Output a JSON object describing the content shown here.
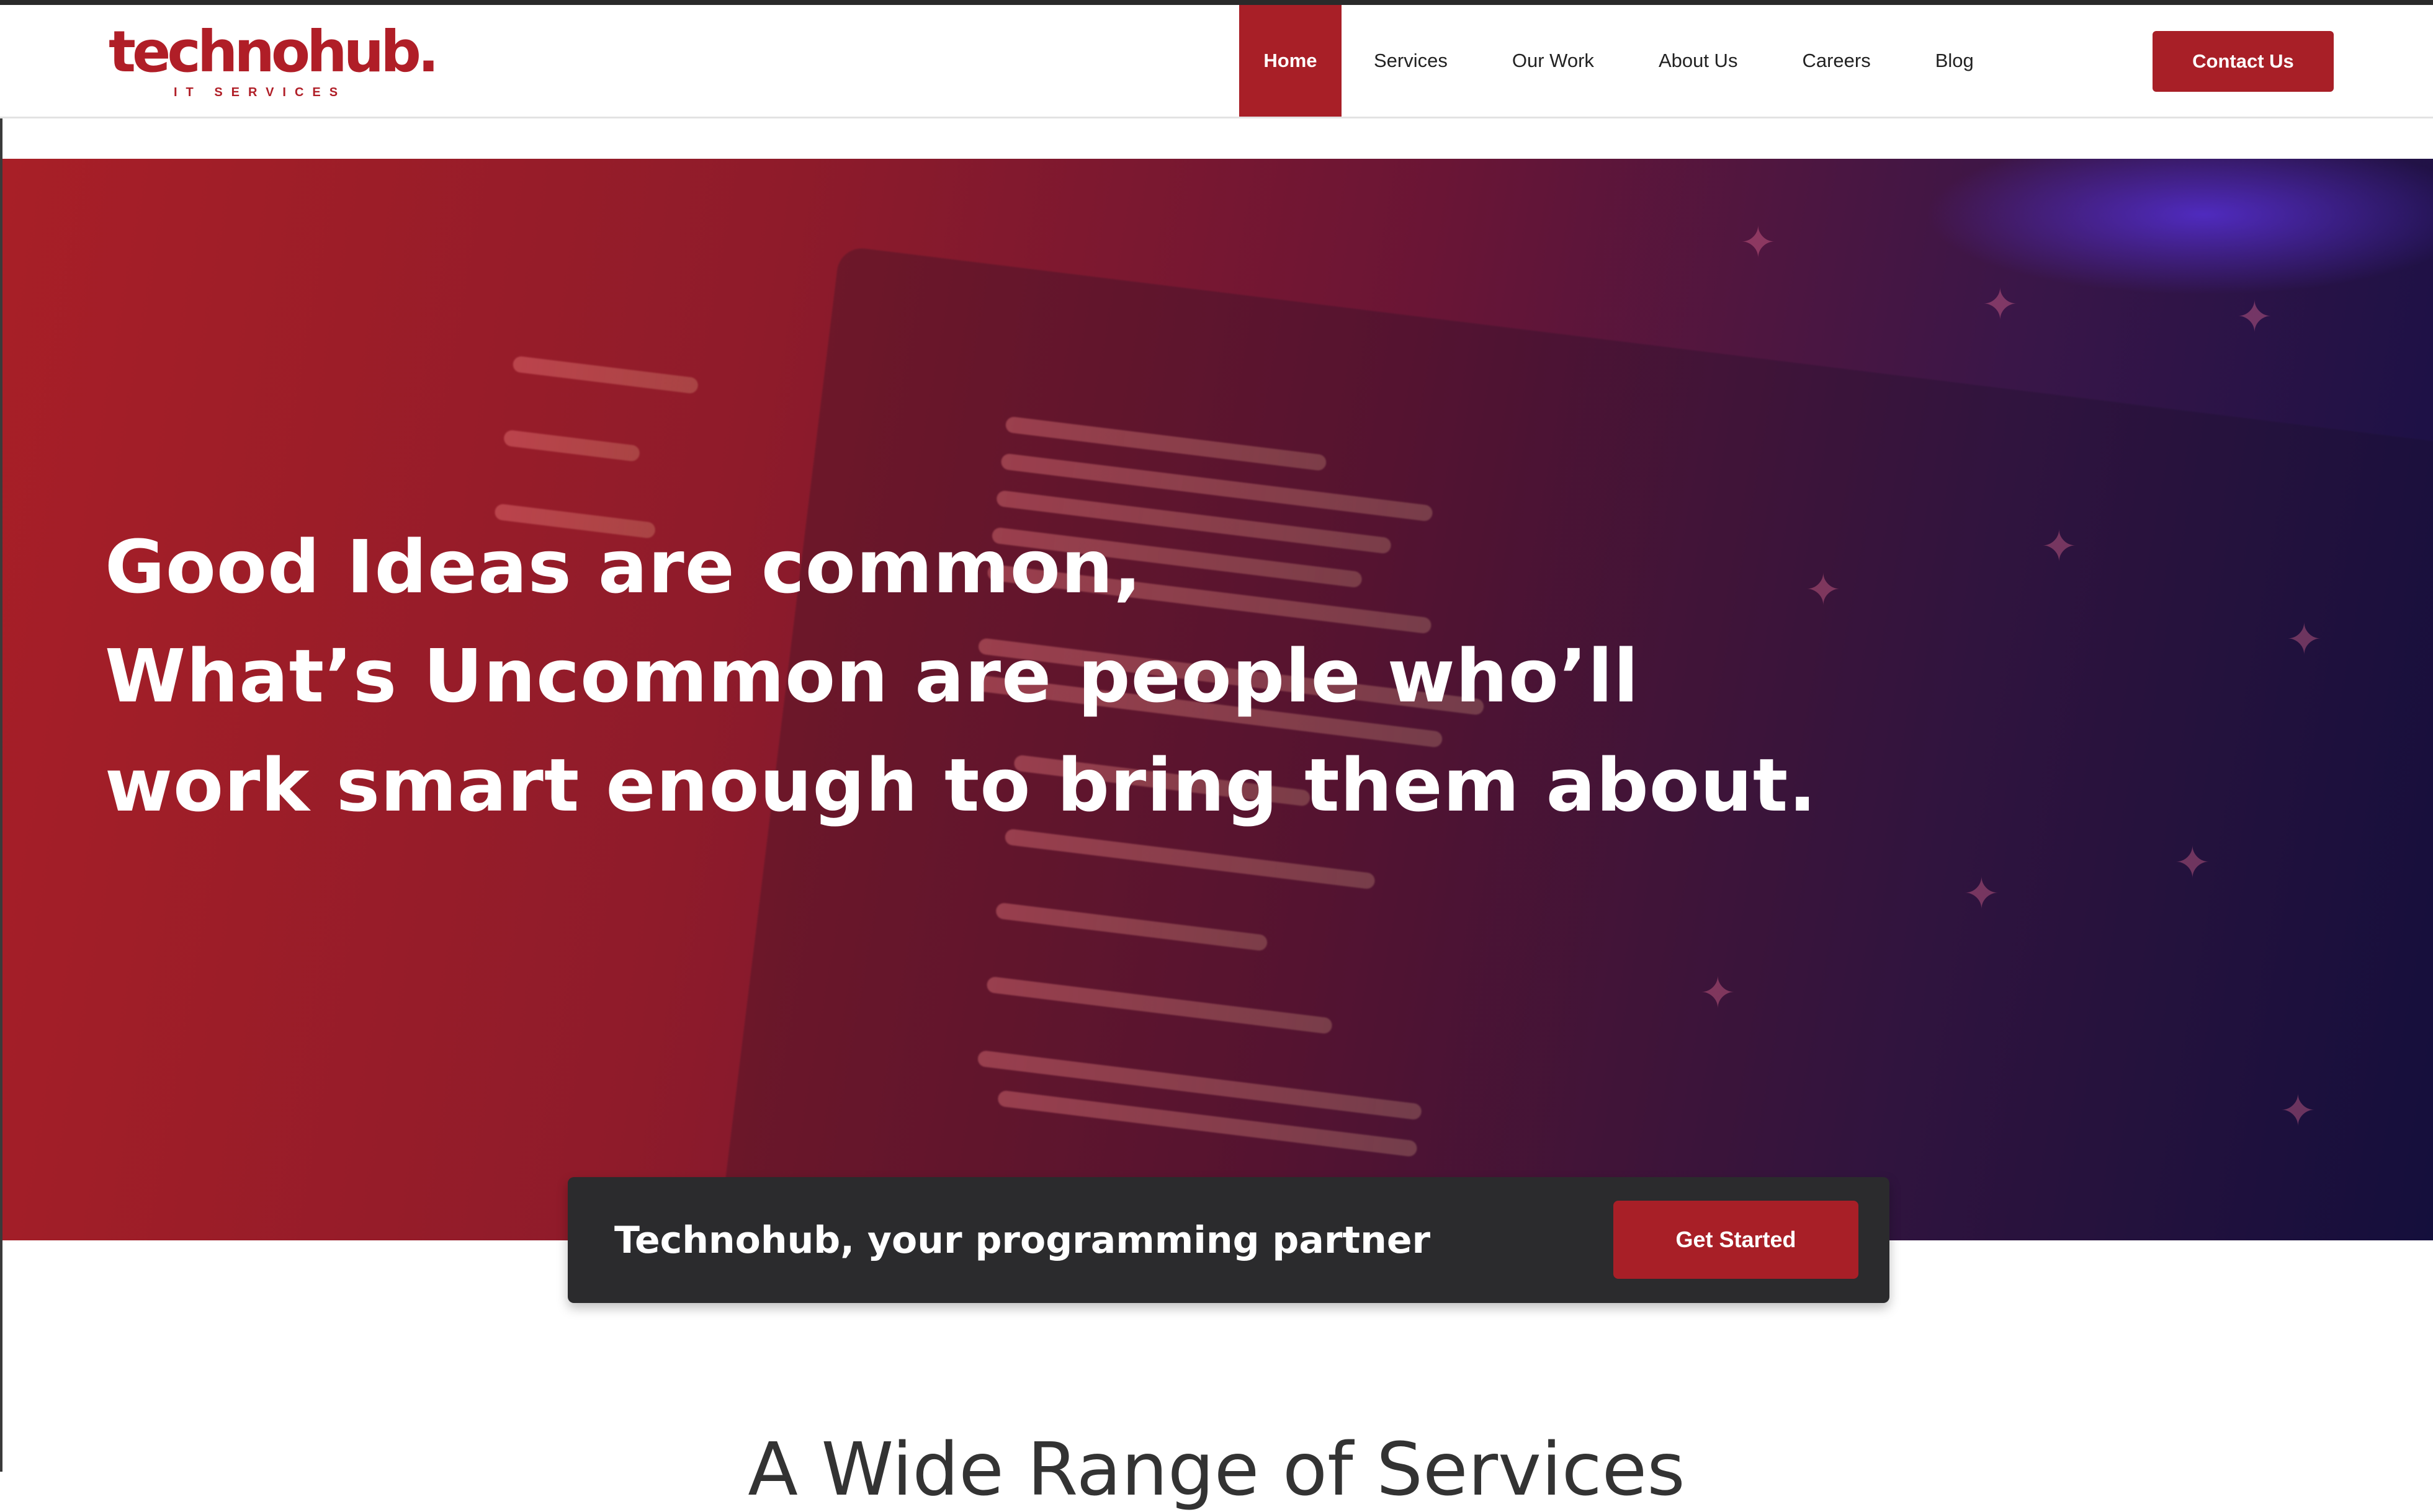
{
  "brand": {
    "name": "technohub.",
    "tagline": "IT SERVICES",
    "color": "#a81f27"
  },
  "nav": {
    "items": [
      {
        "label": "Home",
        "active": true
      },
      {
        "label": "Services",
        "active": false
      },
      {
        "label": "Our Work",
        "active": false
      },
      {
        "label": "About Us",
        "active": false
      },
      {
        "label": "Careers",
        "active": false
      },
      {
        "label": "Blog",
        "active": false
      }
    ],
    "contact_label": "Contact Us"
  },
  "hero": {
    "headline_lines": [
      "Good Ideas are common,",
      "What’s Uncommon are people who’ll",
      "work smart enough to bring them about."
    ],
    "gradient_start": "#a81f27",
    "gradient_end": "#140f45"
  },
  "cta": {
    "text": "Technohub, your programming partner",
    "button_label": "Get Started"
  },
  "section": {
    "heading": "A Wide Range of Services"
  }
}
